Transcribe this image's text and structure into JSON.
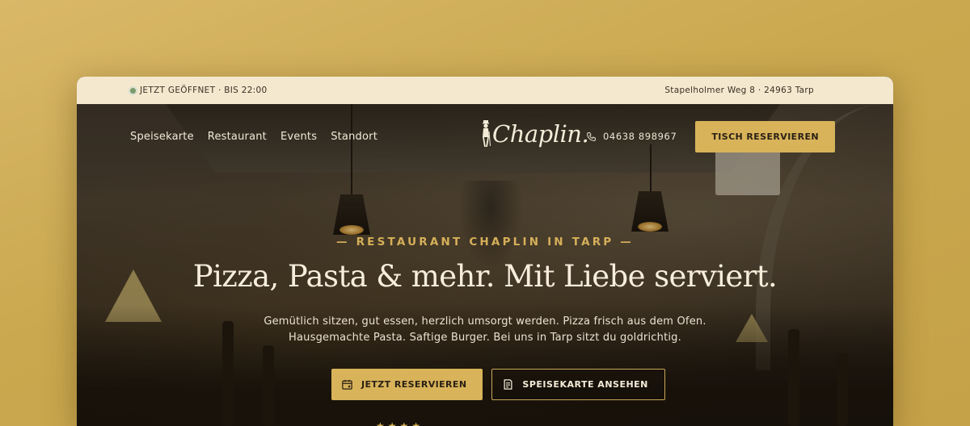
{
  "topbar": {
    "status": "Jetzt geöffnet · bis 22:00",
    "address": "Stapelholmer Weg 8 · 24963 Tarp"
  },
  "nav": {
    "items": [
      "Speisekarte",
      "Restaurant",
      "Events",
      "Standort"
    ],
    "logo": "Chaplin.",
    "phone": "04638 898967",
    "cta": "Tisch reservieren"
  },
  "hero": {
    "eyebrow": "— RESTAURANT CHAPLIN IN TARP —",
    "title": "Pizza, Pasta & mehr. Mit Liebe serviert.",
    "subtitle_line1": "Gemütlich sitzen, gut essen, herzlich umsorgt werden. Pizza frisch aus dem Ofen.",
    "subtitle_line2": "Hausgemachte Pasta. Saftige Burger. Bei uns in Tarp sitzt du goldrichtig.",
    "primary_cta": "Jetzt reservieren",
    "secondary_cta": "Speisekarte ansehen",
    "stars": "★★★★"
  },
  "colors": {
    "gold": "#d8b35a",
    "cream": "#f4e8cf",
    "open_dot": "#7b9a6e"
  },
  "icons": [
    "phone-icon",
    "calendar-icon",
    "menu-card-icon",
    "chaplin-figure-icon"
  ]
}
